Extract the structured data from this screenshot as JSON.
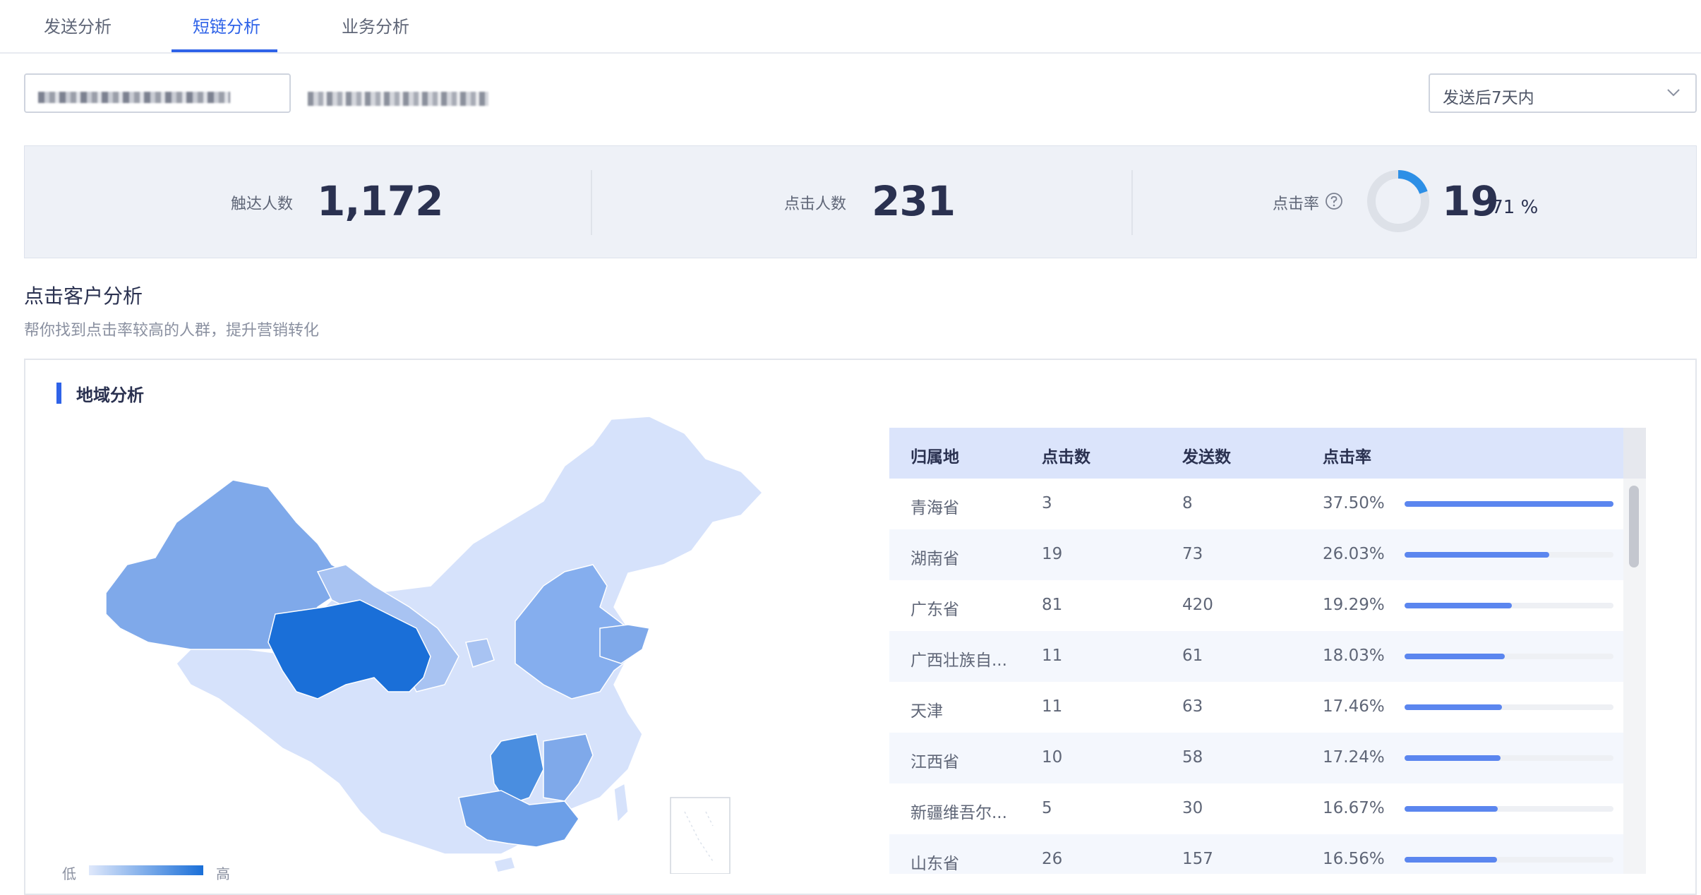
{
  "tabs": [
    {
      "label": "发送分析",
      "active": false
    },
    {
      "label": "短链分析",
      "active": true
    },
    {
      "label": "业务分析",
      "active": false
    }
  ],
  "filters": {
    "time_range": "发送后7天内",
    "selector_icon": "chevron-down-icon"
  },
  "stats": {
    "reach_label": "触达人数",
    "reach_value": "1,172",
    "click_label": "点击人数",
    "click_value": "231",
    "rate_label": "点击率",
    "rate_int": "19",
    "rate_dec": ".71 %",
    "rate_fraction": 0.1971,
    "help_icon": "question-circle-icon"
  },
  "section": {
    "title": "点击客户分析",
    "subtitle": "帮你找到点击率较高的人群，提升营销转化"
  },
  "region_panel": {
    "title": "地域分析",
    "legend_low": "低",
    "legend_high": "高",
    "colors": {
      "accent": "#2f63e8",
      "low": "#dfe8fb",
      "high": "#1a6fd8"
    }
  },
  "table": {
    "headers": [
      "归属地",
      "点击数",
      "发送数",
      "点击率"
    ],
    "rows": [
      {
        "region": "青海省",
        "clicks": "3",
        "sends": "8",
        "rate": "37.50%",
        "share": 1.0
      },
      {
        "region": "湖南省",
        "clicks": "19",
        "sends": "73",
        "rate": "26.03%",
        "share": 0.694
      },
      {
        "region": "广东省",
        "clicks": "81",
        "sends": "420",
        "rate": "19.29%",
        "share": 0.514
      },
      {
        "region": "广西壮族自...",
        "clicks": "11",
        "sends": "61",
        "rate": "18.03%",
        "share": 0.481
      },
      {
        "region": "天津",
        "clicks": "11",
        "sends": "63",
        "rate": "17.46%",
        "share": 0.466
      },
      {
        "region": "江西省",
        "clicks": "10",
        "sends": "58",
        "rate": "17.24%",
        "share": 0.46
      },
      {
        "region": "新疆维吾尔...",
        "clicks": "5",
        "sends": "30",
        "rate": "16.67%",
        "share": 0.445
      },
      {
        "region": "山东省",
        "clicks": "26",
        "sends": "157",
        "rate": "16.56%",
        "share": 0.442
      }
    ]
  }
}
